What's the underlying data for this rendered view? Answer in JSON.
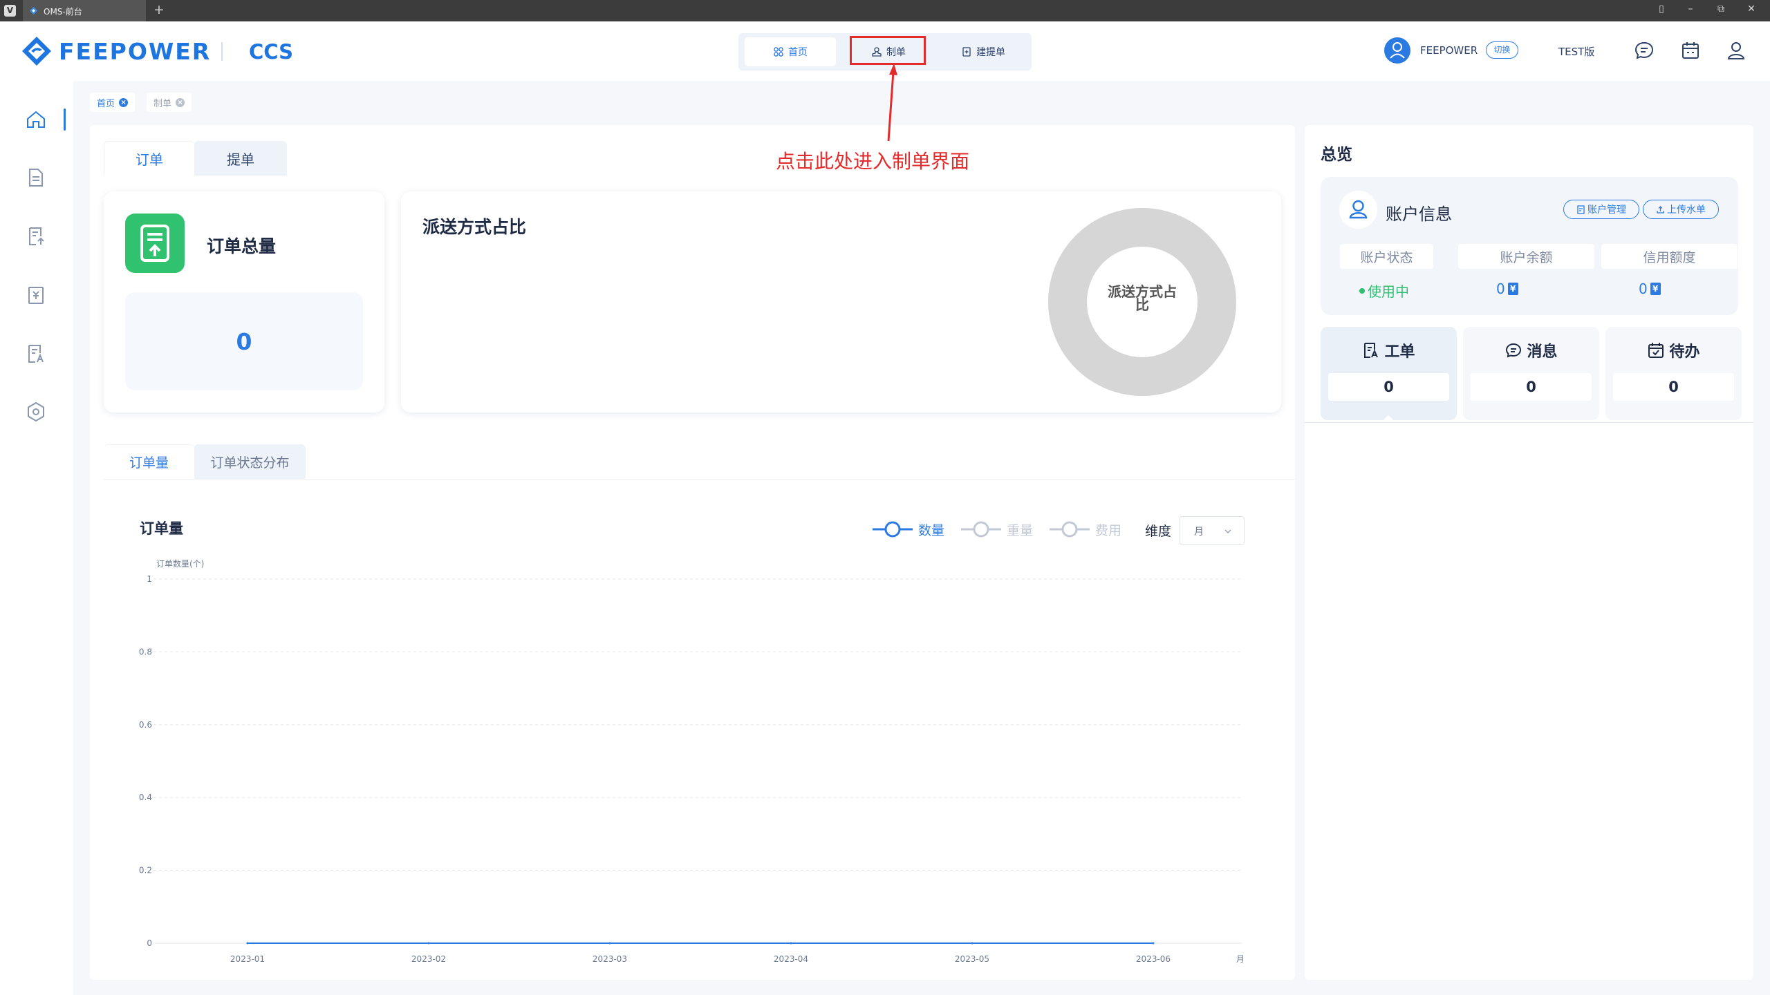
{
  "browser": {
    "tab_title": "OMS-前台",
    "new_tab": "+",
    "controls": [
      "▯",
      "–",
      "⧉",
      "✕"
    ]
  },
  "header": {
    "logo_text": "FEEPOWER",
    "product": "CCS",
    "nav": [
      {
        "label": "首页",
        "icon": "grid-icon",
        "active": true
      },
      {
        "label": "制单",
        "icon": "stamp-icon",
        "active": false
      },
      {
        "label": "建提单",
        "icon": "document-add-icon",
        "active": false
      }
    ],
    "user_name": "FEEPOWER",
    "switch_label": "切换",
    "version": "TEST版"
  },
  "annotation": {
    "text": "点击此处进入制单界面",
    "color": "#e42b2b"
  },
  "breadcrumbs": [
    {
      "label": "首页",
      "active": true
    },
    {
      "label": "制单",
      "active": false
    }
  ],
  "main": {
    "top_tabs": [
      {
        "label": "订单",
        "active": true
      },
      {
        "label": "提单",
        "active": false
      }
    ],
    "order_total": {
      "title": "订单总量",
      "value": "0"
    },
    "delivery": {
      "title": "派送方式占比",
      "donut_label": "派送方式占比"
    },
    "chart_tabs": [
      {
        "label": "订单量",
        "active": true
      },
      {
        "label": "订单状态分布",
        "active": false
      }
    ],
    "chart_title": "订单量",
    "legend": [
      {
        "label": "数量",
        "active": true
      },
      {
        "label": "重量",
        "active": false
      },
      {
        "label": "费用",
        "active": false
      }
    ],
    "dimension_label": "维度",
    "dimension_value": "月"
  },
  "right": {
    "title": "总览",
    "account": {
      "title": "账户信息",
      "manage_btn": "账户管理",
      "upload_btn": "上传水单",
      "columns": [
        "账户状态",
        "账户余额",
        "信用额度"
      ],
      "status": "使用中",
      "balance": "0",
      "credit": "0"
    },
    "quick": [
      {
        "label": "工单",
        "value": "0",
        "icon": "ticket-icon"
      },
      {
        "label": "消息",
        "value": "0",
        "icon": "message-icon"
      },
      {
        "label": "待办",
        "value": "0",
        "icon": "calendar-check-icon"
      }
    ]
  },
  "colors": {
    "primary": "#2a7ae2",
    "brand": "#1f75e0",
    "success": "#2fbf71",
    "annotation": "#e42b2b",
    "donut": "#d6d6d6"
  },
  "chart_data": {
    "type": "line",
    "title": "订单量",
    "ylabel": "订单数量(个)",
    "xlabel": "月",
    "categories": [
      "2023-01",
      "2023-02",
      "2023-03",
      "2023-04",
      "2023-05",
      "2023-06"
    ],
    "series": [
      {
        "name": "数量",
        "values": [
          0,
          0,
          0,
          0,
          0,
          0
        ]
      }
    ],
    "ylim": [
      0,
      1
    ],
    "yticks": [
      "0",
      "0.2",
      "0.4",
      "0.6",
      "0.8",
      "1"
    ],
    "grid": true
  }
}
